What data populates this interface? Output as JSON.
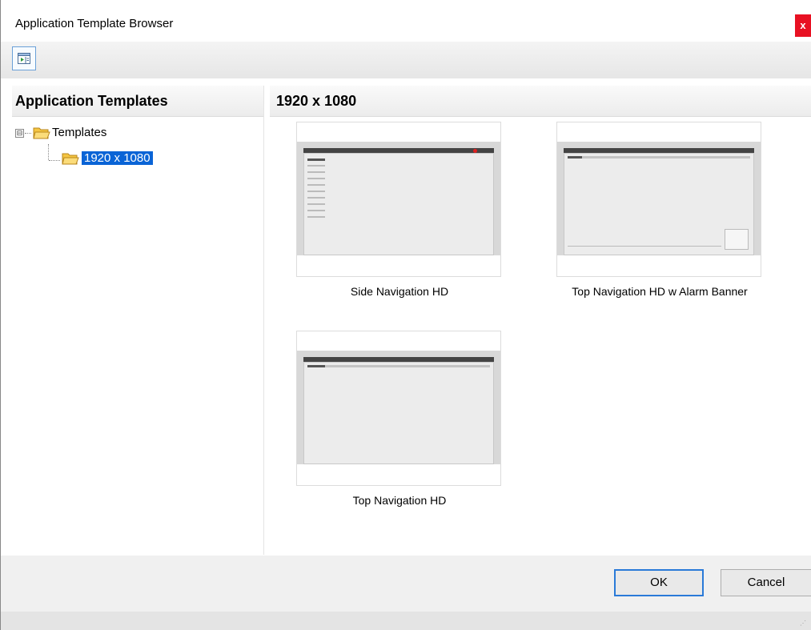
{
  "window": {
    "title": "Application Template Browser",
    "close_label": "x"
  },
  "toolbar": {
    "preview_button_icon": "preview-pane-icon"
  },
  "left_panel": {
    "header": "Application Templates",
    "tree": {
      "root_label": "Templates",
      "expander_symbol": "⊟",
      "child_label": "1920 x 1080"
    }
  },
  "right_panel": {
    "header": "1920 x 1080",
    "templates": [
      {
        "label": "Side Navigation HD"
      },
      {
        "label": "Top Navigation HD w Alarm Banner"
      },
      {
        "label": "Top Navigation HD"
      }
    ]
  },
  "footer": {
    "ok_label": "OK",
    "cancel_label": "Cancel"
  },
  "colors": {
    "selection": "#0a64d6",
    "close": "#e81123",
    "ok_border": "#2a7ad8"
  }
}
